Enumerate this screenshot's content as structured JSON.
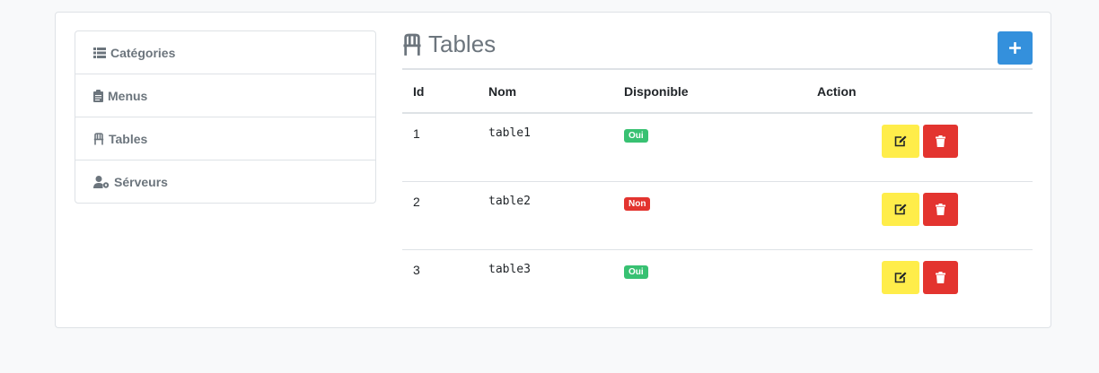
{
  "sidebar": {
    "items": [
      {
        "label": "Catégories",
        "icon": "list-icon"
      },
      {
        "label": "Menus",
        "icon": "clipboard-icon"
      },
      {
        "label": "Tables",
        "icon": "chair-icon"
      },
      {
        "label": "Sérveurs",
        "icon": "user-cog-icon"
      }
    ]
  },
  "main": {
    "title": "Tables",
    "title_icon": "chair-icon",
    "add_icon": "plus-icon",
    "columns": [
      "Id",
      "Nom",
      "Disponible",
      "Action"
    ],
    "rows": [
      {
        "id": "1",
        "nom": "table1",
        "disponible": "Oui",
        "status_color": "#38c172"
      },
      {
        "id": "2",
        "nom": "table2",
        "disponible": "Non",
        "status_color": "#e3342f"
      },
      {
        "id": "3",
        "nom": "table3",
        "disponible": "Oui",
        "status_color": "#38c172"
      }
    ]
  },
  "colors": {
    "primary": "#3490dc",
    "warning": "#ffed4a",
    "danger": "#e3342f",
    "success": "#38c172"
  }
}
